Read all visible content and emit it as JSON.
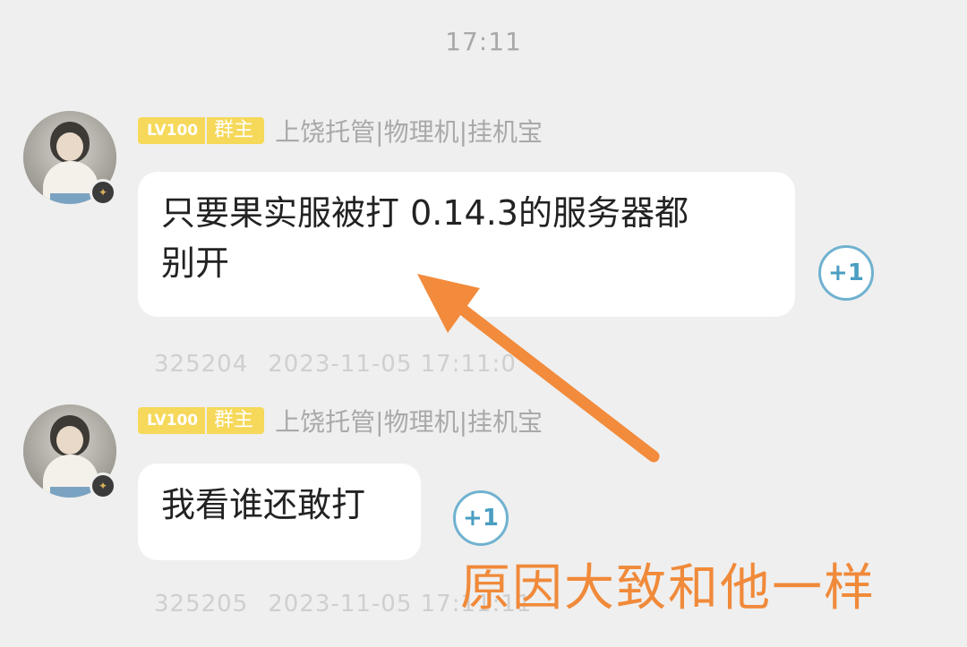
{
  "chat": {
    "time_divider": "17:11",
    "messages": [
      {
        "level_badge": "LV100",
        "role_badge": "群主",
        "group_title": "上饶托管|物理机|挂机宝",
        "text_line1": "只要果实服被打 0.14.3的服务器都",
        "text_line2": "别开",
        "plus_one": "+1",
        "msg_id": "325204",
        "timestamp": "2023-11-05 17:11:0"
      },
      {
        "level_badge": "LV100",
        "role_badge": "群主",
        "group_title": "上饶托管|物理机|挂机宝",
        "text_line1": "我看谁还敢打",
        "plus_one": "+1",
        "msg_id": "325205",
        "timestamp": "2023-11-05 17:11:11"
      }
    ]
  },
  "annotation": {
    "text": "原因大致和他一样",
    "color": "#f08a3a"
  },
  "colors": {
    "background": "#efefef",
    "bubble": "#ffffff",
    "badge": "#f6d85a",
    "plus_one": "#6fb2cf"
  }
}
